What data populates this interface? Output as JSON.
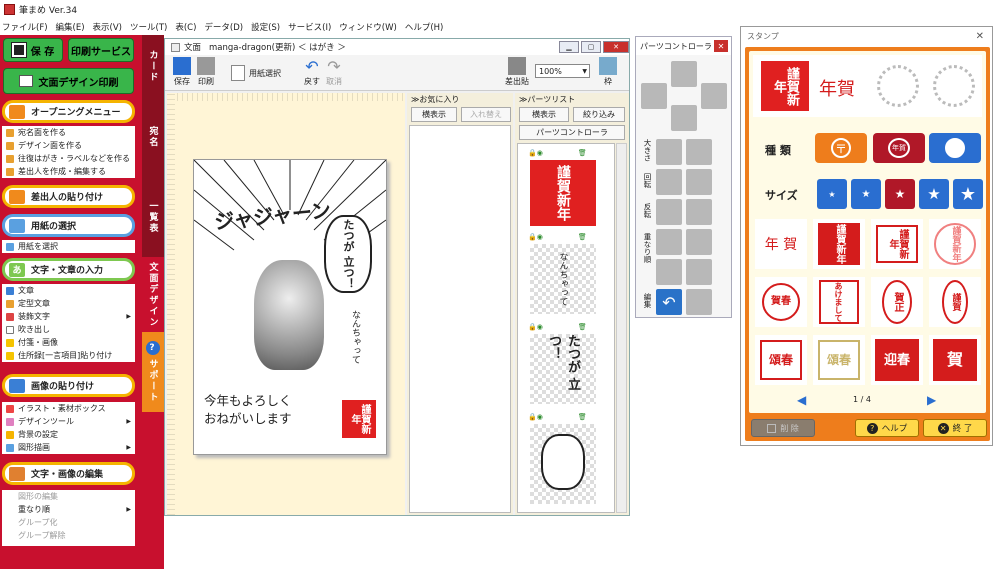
{
  "app": {
    "title": "筆まめ Ver.34"
  },
  "menu": [
    "ファイル(F)",
    "編集(E)",
    "表示(V)",
    "ツール(T)",
    "表(C)",
    "データ(D)",
    "設定(S)",
    "サービス(I)",
    "ウィンドウ(W)",
    "ヘルプ(H)"
  ],
  "left": {
    "save": "保 存",
    "print_service": "印刷サービス",
    "design_print": "文面デザイン印刷",
    "opening": "オープニングメニュー",
    "opening_items": [
      "宛名面を作る",
      "デザイン面を作る",
      "往復はがき・ラベルなどを作る",
      "差出人を作成・編集する"
    ],
    "sender": "差出人の貼り付け",
    "paper": "用紙の選択",
    "paper_items": [
      "用紙を選択"
    ],
    "text": "文字・文章の入力",
    "text_items": [
      "文章",
      "定型文章",
      "装飾文字",
      "吹き出し",
      "付箋・画像",
      "住所録[一言項目]貼り付け"
    ],
    "image": "画像の貼り付け",
    "image_items": [
      "イラスト・素材ボックス",
      "デザインツール",
      "背景の設定",
      "図形描画"
    ],
    "edit": "文字・画像の編集",
    "edit_items": [
      "図形の編集",
      "重なり順",
      "グループ化",
      "グループ解除"
    ]
  },
  "tabs": [
    "カード",
    "宛名",
    "一覧表",
    "文面デザイン",
    "サポート"
  ],
  "doc": {
    "title": "文面",
    "filename": "manga-dragon(更新) ＜ はがき ＞",
    "tools": {
      "save": "保存",
      "print": "印刷",
      "paper": "用紙選択",
      "undo": "戻す",
      "redo": "取消",
      "sender": "差出貼",
      "zoom": "100%",
      "frame": "枠"
    },
    "favorites": {
      "header": "≫お気に入り",
      "show": "横表示",
      "swap": "入れ替え"
    },
    "parts": {
      "header": "≫パーツリスト",
      "show": "横表示",
      "filter": "絞り込み",
      "controller": "パーツコントローラ"
    },
    "card": {
      "shout": "ジャジャーン",
      "bubble": "たつが 立つ！",
      "side": "なんちゃって",
      "greeting1": "今年もよろしく",
      "greeting2": "おねがいします",
      "stamp": "謹賀新年"
    },
    "parts_texts": [
      "なんちゃって",
      "たつが 立つ！"
    ]
  },
  "pc": {
    "title": "パーツコントローラ",
    "labels": [
      "大きさ",
      "回転",
      "反転",
      "重なり順",
      "編集"
    ]
  },
  "stamp": {
    "title": "スタンプ",
    "preview_text": "年賀",
    "kind_label": "種 類",
    "size_label": "サイズ",
    "kind_icons": [
      "〒",
      "年賀",
      "person"
    ],
    "cells": [
      "年 賀",
      "謹賀新年",
      "謹賀新年",
      "謹賀新年",
      "賀春",
      "あけまして",
      "賀正",
      "謹賀",
      "頌春",
      "頌春",
      "迎春",
      "賀"
    ],
    "page": "1 / 4",
    "delete": "削 除",
    "help": "ヘルプ",
    "close": "終 了"
  },
  "colors": {
    "brand_red": "#c8102e",
    "accent_orange": "#ee7d1c",
    "blue": "#2a6ed0"
  }
}
